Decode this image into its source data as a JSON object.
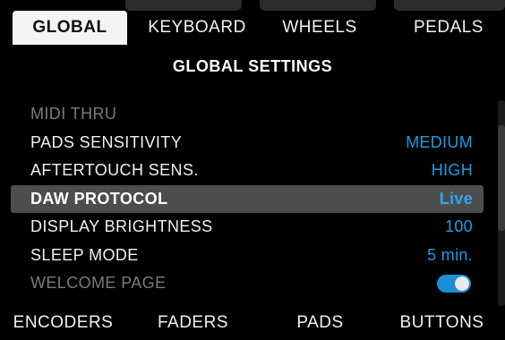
{
  "tabs": [
    {
      "label": "GLOBAL",
      "active": true
    },
    {
      "label": "KEYBOARD",
      "active": false
    },
    {
      "label": "WHEELS",
      "active": false
    },
    {
      "label": "PEDALS",
      "active": false
    }
  ],
  "title": "GLOBAL SETTINGS",
  "settings": [
    {
      "label": "MIDI THRU",
      "value": "",
      "state": "dim"
    },
    {
      "label": "PADS SENSITIVITY",
      "value": "MEDIUM",
      "state": "normal"
    },
    {
      "label": "AFTERTOUCH SENS.",
      "value": "HIGH",
      "state": "normal"
    },
    {
      "label": "DAW PROTOCOL",
      "value": "Live",
      "state": "selected"
    },
    {
      "label": "DISPLAY BRIGHTNESS",
      "value": "100",
      "state": "normal"
    },
    {
      "label": "SLEEP MODE",
      "value": "5 min.",
      "state": "normal"
    },
    {
      "label": "WELCOME PAGE",
      "value": "",
      "state": "dim",
      "toggle": true,
      "toggle_on": true
    }
  ],
  "bottom_labels": [
    "ENCODERS",
    "FADERS",
    "PADS",
    "BUTTONS"
  ],
  "colors": {
    "value_blue": "#1b9ce0",
    "selected_row_bg": "#4d4d4d",
    "active_tab_bg": "#f4f4f4",
    "toggle_on": "#1b8fd6"
  }
}
